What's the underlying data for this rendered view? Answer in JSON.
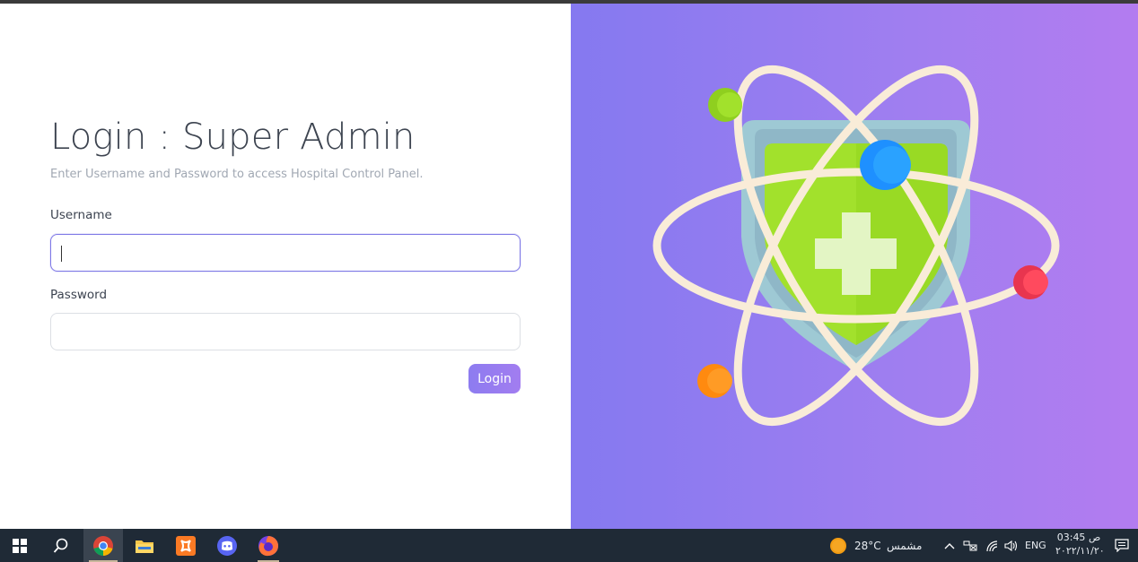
{
  "login": {
    "title": "Login : Super Admin",
    "subtitle": "Enter Username and Password to access Hospital Control Panel.",
    "username_label": "Username",
    "username_value": "",
    "password_label": "Password",
    "password_value": "",
    "login_button": "Login"
  },
  "colors": {
    "accent": "#8d7cf0",
    "panel_gradient_start": "#8579f0",
    "panel_gradient_end": "#b37cf0",
    "shield_green": "#a2e12c",
    "shield_border": "#9ec9d4"
  },
  "taskbar": {
    "apps": [
      "windows-start-icon",
      "search-icon",
      "chrome-icon",
      "file-explorer-icon",
      "xampp-icon",
      "discord-icon",
      "firefox-icon"
    ],
    "weather_temp": "28°C",
    "weather_desc": "مشمس",
    "language": "ENG",
    "time": "03:45 ص",
    "date": "٢٠٢٢/١١/٢٠"
  }
}
